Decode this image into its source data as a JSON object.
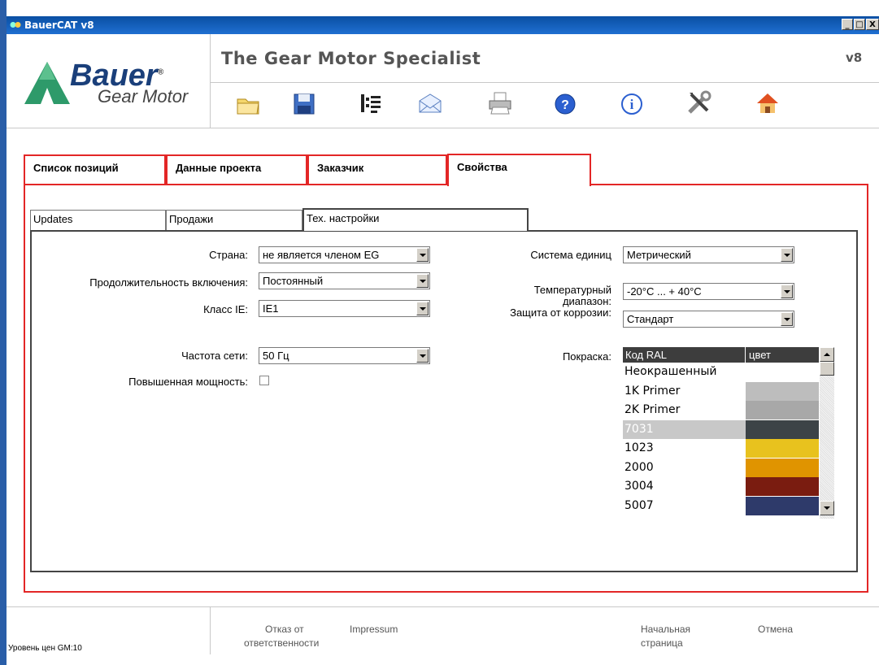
{
  "window": {
    "title": "BauerCAT v8",
    "min": "_",
    "max": "□",
    "close": "X"
  },
  "header": {
    "slogan": "The Gear Motor Specialist",
    "version": "v8",
    "logo_brand": "Bauer",
    "logo_reg": "®",
    "logo_sub": "Gear Motor"
  },
  "toolbar": [
    "folder-icon",
    "save-icon",
    "network-icon",
    "mail-icon",
    "print-icon",
    "help-icon",
    "info-icon",
    "tools-icon",
    "home-icon"
  ],
  "main_tabs": [
    "Список позиций",
    "Данные проекта",
    "Заказчик",
    "Свойства"
  ],
  "sub_tabs": [
    "Updates",
    "Продажи",
    "Тех. настройки"
  ],
  "left_form": {
    "country_label": "Страна:",
    "country_value": "не является членом EG",
    "duty_label": "Продолжительность включения:",
    "duty_value": "Постоянный",
    "ie_label": "Класс IE:",
    "ie_value": "IE1",
    "freq_label": "Частота сети:",
    "freq_value": "50 Гц",
    "power_label": "Повышенная мощность:"
  },
  "right_form": {
    "units_label": "Система единиц",
    "units_value": "Метрический",
    "temp_label_1": "Температурный",
    "temp_label_2": "диапазон:",
    "temp_value": "-20°C ... + 40°C",
    "corrosion_label": "Защита от коррозии:",
    "corrosion_value": "Стандарт",
    "paint_label": "Покраска:"
  },
  "ral_table": {
    "col_code": "Код RAL",
    "col_color": "цвет",
    "rows": [
      {
        "code": "Неокрашенный",
        "color": ""
      },
      {
        "code": "1K Primer",
        "color": "#bdbdbd"
      },
      {
        "code": "2K Primer",
        "color": "#a8a8a8"
      },
      {
        "code": "7031",
        "color": "#3c4347",
        "selected": true
      },
      {
        "code": "1023",
        "color": "#e8c21e"
      },
      {
        "code": "2000",
        "color": "#e09400"
      },
      {
        "code": "3004",
        "color": "#7a1c10"
      },
      {
        "code": "5007",
        "color": "#2e3a6a"
      }
    ]
  },
  "footer": {
    "disclaimer_1": "Отказ от",
    "disclaimer_2": "ответственности",
    "impressum": "Impressum",
    "home_1": "Начальная",
    "home_2": "страница",
    "cancel": "Отмена",
    "price_level": "Уровень цен GM:10"
  },
  "colors": {
    "accent_red": "#e32626",
    "title_blue": "#0a4fa3"
  }
}
